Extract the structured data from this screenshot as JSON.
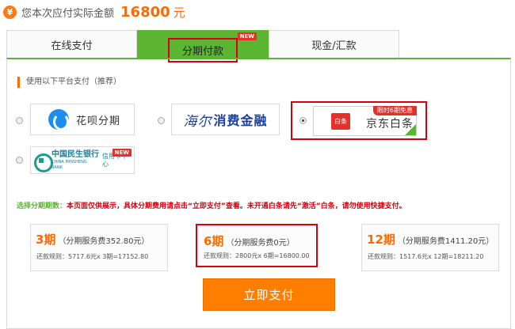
{
  "header": {
    "icon": "yen-icon",
    "label": "您本次应付实际金额",
    "amount": "16800",
    "unit": "元"
  },
  "tabs": [
    {
      "label": "在线支付",
      "active": false
    },
    {
      "label": "分期付款",
      "active": true,
      "badge": "NEW"
    },
    {
      "label": "现金/汇款",
      "active": false
    }
  ],
  "section_title": "使用以下平台支付（推荐）",
  "platforms": {
    "huabei": {
      "name": "花呗分期",
      "selected": false
    },
    "haier": {
      "name_a": "海尔",
      "name_b": "消费金融",
      "selected": false
    },
    "jd": {
      "logo": "白条",
      "name": "京东白条",
      "promo": "限时6期免息",
      "selected": true
    },
    "minsheng": {
      "name_cn": "中国民生银行",
      "name_en": "CHINA MINSHENG BANK",
      "card": "信用卡中心",
      "badge": "NEW",
      "selected": false
    }
  },
  "notice": {
    "label": "选择分期期数：",
    "text": "本页面仅供展示，具体分期费用请点击“立即支付”查看。未开通白条请先“激活”白条，请勿使用快捷支付。"
  },
  "plans": [
    {
      "num": "3期",
      "fee": "（分期服务费352.80元）",
      "rule": "还款规则：5717.6元x 3期=17152.80",
      "selected": false
    },
    {
      "num": "6期",
      "fee": "（分期服务费0元）",
      "rule": "还款规则：2800元x 6期=16800.00",
      "selected": true
    },
    {
      "num": "12期",
      "fee": "（分期服务费1411.20元）",
      "rule": "还款规则：1517.6元x 12期=18211.20",
      "selected": false
    }
  ],
  "submit_label": "立即支付",
  "colors": {
    "accent": "#ff6a00",
    "tab_green": "#5cb531",
    "highlight_red": "#d7000f",
    "button": "#ff7e00"
  }
}
